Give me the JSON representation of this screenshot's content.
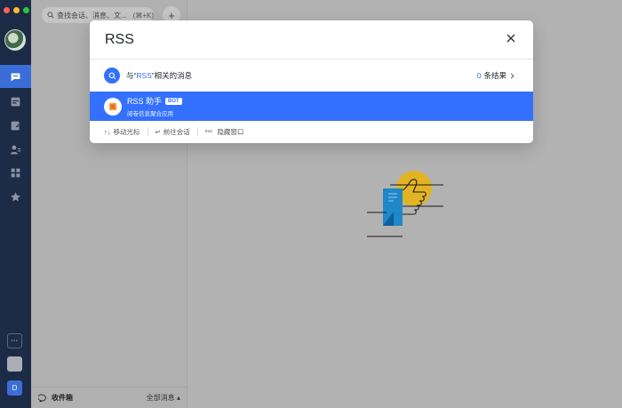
{
  "window": {
    "traffic_lights": [
      "#ff5f57",
      "#febc2e",
      "#28c840"
    ]
  },
  "rail": {
    "items": [
      {
        "name": "messages-icon",
        "active": true
      },
      {
        "name": "calendar-icon",
        "active": false
      },
      {
        "name": "docs-icon",
        "active": false
      },
      {
        "name": "contacts-icon",
        "active": false
      },
      {
        "name": "apps-icon",
        "active": false
      },
      {
        "name": "star-icon",
        "active": false
      }
    ],
    "bottom_avatar_letter": "D"
  },
  "chatlist": {
    "search_placeholder": "查找会话、消息、文...",
    "search_shortcut": "(⌘+K)",
    "plus_label": "+",
    "footer_inbox": "收件箱",
    "footer_all": "全部消息 ▴"
  },
  "modal": {
    "query": "RSS",
    "message_prefix": "与“",
    "message_keyword": "RSS",
    "message_suffix": "”相关的消息",
    "result_count": "0",
    "result_count_suffix": "条结果",
    "result": {
      "title": "RSS 助手",
      "badge": "BOT",
      "subtitle": "阅卷信息聚合应用"
    },
    "hints": {
      "move_keys": "↑↓",
      "move_label": "移动光标",
      "enter_key": "↵",
      "enter_label": "前往会话",
      "esc_key": "esc",
      "esc_label": "隐藏窗口"
    }
  },
  "colors": {
    "accent": "#3370ff",
    "rail": "#1c2b46",
    "illustration_yellow": "#e2b325",
    "illustration_blue": "#1e88c8"
  }
}
